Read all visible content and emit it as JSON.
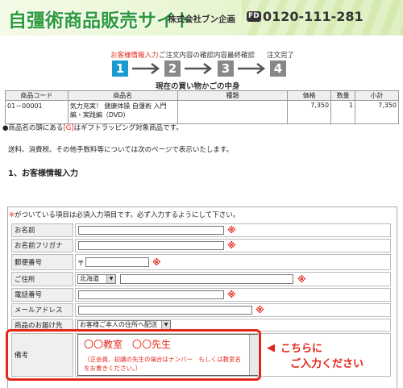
{
  "header": {
    "logo": "自彊術商品販売サイト",
    "company": "株式会社ブン企画",
    "free_dial": "FD",
    "phone": "0120-111-281"
  },
  "steps": [
    {
      "label": "お客様情報入力",
      "number": "1",
      "active": true
    },
    {
      "label": "ご注文内容の確認",
      "number": "2",
      "active": false
    },
    {
      "label": "内容最終確認",
      "number": "3",
      "active": false
    },
    {
      "label": "注文完了",
      "number": "4",
      "active": false
    }
  ],
  "cart": {
    "title": "現在の買い物かごの中身",
    "headers": [
      "商品コード",
      "商品名",
      "種類",
      "価格",
      "数量",
      "小計"
    ],
    "rows": [
      [
        "01－00001",
        "気力充実！ 健康体操 自彊術 入門編・実践編（DVD）",
        "",
        "7,350",
        "1",
        "7,350"
      ]
    ]
  },
  "gift_note": {
    "prefix": "●商品名の頭にある",
    "tag": "[G]",
    "suffix": "はギフトラッピング対象商品です。"
  },
  "shipping_note": "送料、消費税、その他手数料等については次のページで表示いたします。",
  "section_title": "1、お客様情報入力",
  "form": {
    "required_note_mark": "※",
    "required_note": "がついている項目は必須入力項目です。必ず入力するようにして下さい。",
    "mark": "※",
    "name_label": "お名前",
    "kana_label": "お名前フリガナ",
    "zip_label": "郵便番号",
    "zip_prefix": "〒",
    "address_label": "ご住所",
    "prefecture_value": "北海道",
    "phone_label": "電話番号",
    "email_label": "メールアドレス",
    "delivery_label": "商品のお届け先",
    "delivery_value": "お客様ご本人の住所へ配送",
    "notes_label": "備考",
    "notes_line1": "〇〇教室　〇〇先生",
    "notes_line2": "（正会員、初講の先生の場合はナンバー　もしくは教室名をお書きください。）"
  },
  "callout": {
    "arrow": "◀",
    "line1": "こちらに",
    "line2": "ご入力ください"
  },
  "colors": {
    "accent_red": "#e4261a",
    "step_blue": "#1b9bd0",
    "logo_green": "#2e9b3c"
  }
}
